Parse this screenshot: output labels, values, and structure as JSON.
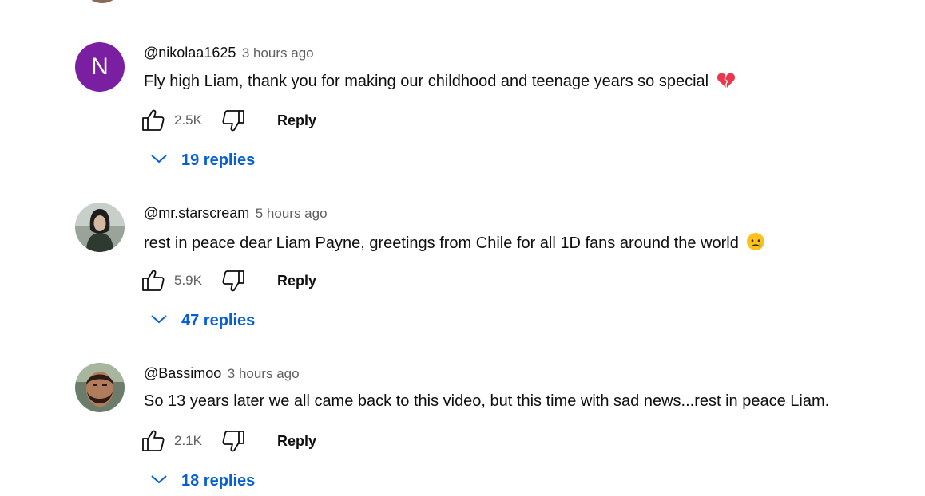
{
  "comments": [
    {
      "author": "@nikolaa1625",
      "time": "3 hours ago",
      "avatar_letter": "N",
      "text": "Fly high Liam, thank you for making our childhood and teenage years so special",
      "emoji": "broken-heart-emoji",
      "likes": "2.5K",
      "reply_label": "Reply",
      "replies_label": "19 replies"
    },
    {
      "author": "@mr.starscream",
      "time": "5 hours ago",
      "text": "rest in peace dear Liam Payne, greetings from Chile for all 1D fans around the world",
      "emoji": "crying-face-emoji",
      "likes": "5.9K",
      "reply_label": "Reply",
      "replies_label": "47 replies"
    },
    {
      "author": "@Bassimoo",
      "time": "3 hours ago",
      "text": "So 13 years later we all came back to this video, but this time with sad news...rest in peace Liam.",
      "likes": "2.1K",
      "reply_label": "Reply",
      "replies_label": "18 replies"
    }
  ],
  "colors": {
    "link_blue": "#065fd4",
    "secondary_text": "#606060",
    "avatar_purple": "#7b1fa2"
  }
}
